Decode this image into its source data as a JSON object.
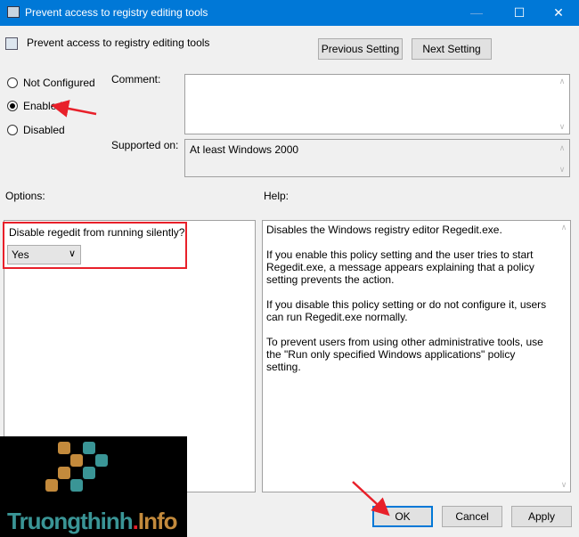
{
  "window": {
    "title": "Prevent access to registry editing tools",
    "minimize": "—",
    "maximize": "☐",
    "close": "✕"
  },
  "header": {
    "policy_name": "Prevent access to registry editing tools",
    "previous_setting": "Previous Setting",
    "next_setting": "Next Setting"
  },
  "state": {
    "options": [
      "Not Configured",
      "Enabled",
      "Disabled"
    ],
    "selected": "Enabled"
  },
  "comment": {
    "label": "Comment:",
    "value": ""
  },
  "supported": {
    "label": "Supported on:",
    "value": "At least Windows 2000"
  },
  "options_panel": {
    "label": "Options:",
    "setting_label": "Disable regedit from running silently?",
    "select_value": "Yes"
  },
  "help_panel": {
    "label": "Help:",
    "paragraphs": [
      "Disables the Windows registry editor Regedit.exe.",
      "If you enable this policy setting and the user tries to start Regedit.exe, a message appears explaining that a policy setting prevents the action.",
      "If you disable this policy setting or do not configure it, users can run Regedit.exe normally.",
      "To prevent users from using other administrative tools, use the \"Run only specified Windows applications\" policy setting."
    ]
  },
  "footer": {
    "ok": "OK",
    "cancel": "Cancel",
    "apply": "Apply"
  },
  "watermark": {
    "text_main": "Truongthinh",
    "text_dot": ".",
    "text_tld": "Info"
  },
  "colors": {
    "titlebar": "#0078d7",
    "annotation": "#e8202a",
    "logo_orange": "#c38a3c",
    "logo_teal": "#3a9596"
  }
}
